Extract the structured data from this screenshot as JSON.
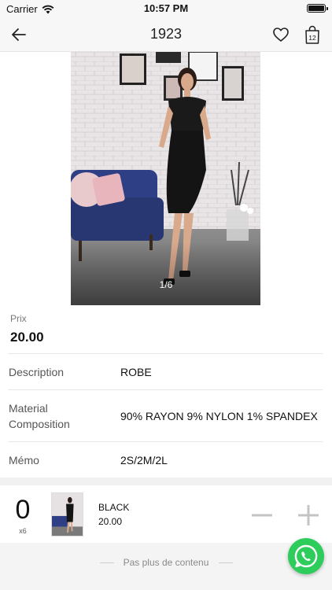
{
  "status_bar": {
    "carrier": "Carrier",
    "time": "10:57 PM"
  },
  "navbar": {
    "title": "1923",
    "cart_count": "12",
    "icons": [
      "back-arrow-icon",
      "heart-icon",
      "shopping-bag-icon"
    ]
  },
  "gallery": {
    "pager": "1/6"
  },
  "product": {
    "price_label": "Prix",
    "price": "20.00",
    "details": [
      {
        "label": "Description",
        "value": "ROBE"
      },
      {
        "label": "Material\nComposition",
        "value": "90% RAYON 9% NYLON 1% SPANDEX"
      },
      {
        "label": "Mémo",
        "value": "2S/2M/2L"
      }
    ]
  },
  "cart_row": {
    "quantity": "0",
    "multiplier": "x6",
    "color": "BLACK",
    "price": "20.00"
  },
  "footer": {
    "end_text": "Pas plus de contenu"
  },
  "colors": {
    "whatsapp": "#2ecc5b",
    "nav_bg": "#f7f7f7"
  }
}
